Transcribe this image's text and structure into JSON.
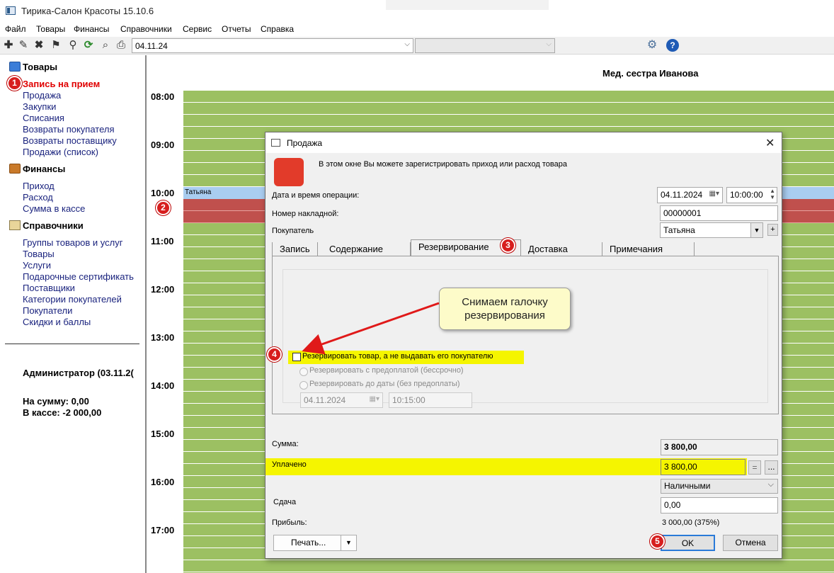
{
  "window": {
    "title": "Тирика-Салон Красоты 15.10.6"
  },
  "menu": [
    "Файл",
    "Товары",
    "Финансы",
    "Справочники",
    "Сервис",
    "Отчеты",
    "Справка"
  ],
  "toolbar": {
    "date_value": "04.11.24",
    "second_combo": ""
  },
  "sidebar": {
    "groups": [
      {
        "title": "Товары",
        "items": [
          "Запись на прием",
          "Продажа",
          "Закупки",
          "Списания",
          "Возвраты покупателя",
          "Возвраты поставщику",
          "Продажи (список)"
        ]
      },
      {
        "title": "Финансы",
        "items": [
          "Приход",
          "Расход",
          "Сумма в кассе"
        ]
      },
      {
        "title": "Справочники",
        "items": [
          "Группы товаров и услуг",
          "Товары",
          "Услуги",
          "Подарочные сертификать",
          "Поставщики",
          "Категории покупателей",
          "Покупатели",
          "Скидки и баллы"
        ]
      }
    ],
    "user": "Администратор (03.11.2(",
    "sum_label": "На сумму: 0,00",
    "cash_label": "В кассе: -2 000,00"
  },
  "schedule": {
    "staff": "Мед. сестра Иванова",
    "hours": [
      "08:00",
      "09:00",
      "10:00",
      "11:00",
      "12:00",
      "13:00",
      "14:00",
      "15:00",
      "16:00",
      "17:00"
    ],
    "appointment": "Татьяна"
  },
  "dialog": {
    "title": "Продажа",
    "info": "В этом окне Вы можете зарегистрировать приход или расход товара",
    "date_label": "Дата и время операции:",
    "date": "04.11.2024",
    "time": "10:00:00",
    "invoice_label": "Номер накладной:",
    "invoice": "00000001",
    "customer_label": "Покупатель",
    "customer": "Татьяна",
    "tabs": [
      "Запись",
      "Содержание",
      "Резервирование",
      "Доставка",
      "Примечания"
    ],
    "reserve": {
      "checkbox": "Резервировать товар, а не выдавать его покупателю",
      "opt1": "Резервировать с предоплатой (бессрочно)",
      "opt2": "Резервировать до даты (без предоплаты)",
      "date": "04.11.2024",
      "time": "10:15:00"
    },
    "sum_label": "Сумма:",
    "sum": "3 800,00",
    "paid_label": "Уплачено",
    "paid": "3 800,00",
    "eq_btn": "=",
    "more_btn": "...",
    "payment_method": "Наличными",
    "change_label": "Сдача",
    "change": "0,00",
    "profit_label": "Прибыль:",
    "profit": "3 000,00 (375%)",
    "print_btn": "Печать...",
    "ok_btn": "OK",
    "cancel_btn": "Отмена"
  },
  "annotations": {
    "callout": "Снимаем галочку резервирования",
    "badges": [
      "1",
      "2",
      "3",
      "4",
      "5"
    ]
  },
  "colors": {
    "accent_red": "#d71e1e",
    "highlight_yellow": "#f5f500",
    "schedule_green": "#9cc062",
    "appointment_blue": "#a9cdf0",
    "busy_red": "#c0504d"
  }
}
